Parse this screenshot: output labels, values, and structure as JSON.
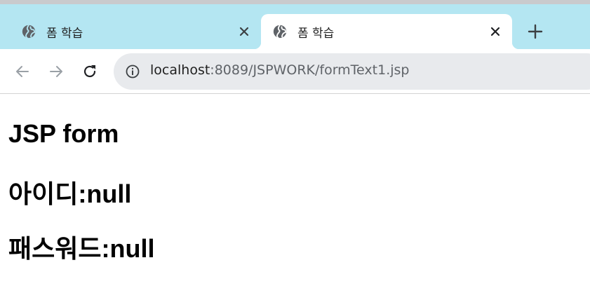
{
  "tabs": [
    {
      "title": "폼 학습",
      "active": false
    },
    {
      "title": "폼 학습",
      "active": true
    }
  ],
  "address_bar": {
    "host": "localhost",
    "path": ":8089/JSPWORK/formText1.jsp"
  },
  "page": {
    "heading": "JSP form",
    "id_line": "아이디:null",
    "pw_line": "패스워드:null"
  },
  "colors": {
    "tabstrip": "#b4e6f2",
    "omnibox": "#e8eaed"
  },
  "icons": {
    "favicon": "globe-icon",
    "tab_close": "close-icon",
    "new_tab": "plus-icon",
    "back": "back-arrow-icon",
    "forward": "forward-arrow-icon",
    "reload": "reload-icon",
    "site_info": "info-icon"
  }
}
